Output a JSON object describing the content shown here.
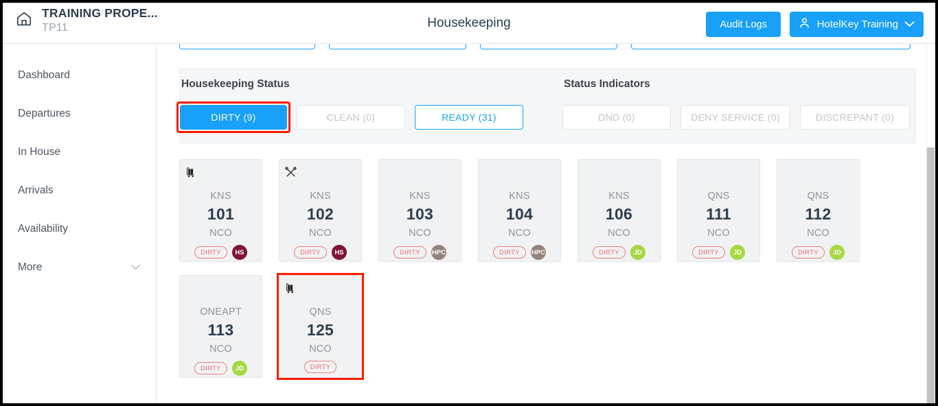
{
  "header": {
    "home_icon": "home-icon",
    "property_name": "TRAINING PROPE...",
    "property_code": "TP11",
    "page_title": "Housekeeping",
    "audit_logs_label": "Audit Logs",
    "user_icon": "person-icon",
    "user_name": "HotelKey Training",
    "user_chevron": "⌄",
    "accent_color": "#18a0fb"
  },
  "sidebar": {
    "items": [
      {
        "label": "Dashboard",
        "chevron": ""
      },
      {
        "label": "Departures",
        "chevron": ""
      },
      {
        "label": "In House",
        "chevron": ""
      },
      {
        "label": "Arrivals",
        "chevron": ""
      },
      {
        "label": "Availability",
        "chevron": ""
      },
      {
        "label": "More",
        "chevron": "⌄"
      }
    ]
  },
  "filters": {
    "housekeeping_status": {
      "label": "Housekeeping Status",
      "buttons": [
        {
          "label": "DIRTY (9)",
          "state": "active",
          "selected": true
        },
        {
          "label": "CLEAN (0)",
          "state": "disabled",
          "selected": false
        },
        {
          "label": "READY (31)",
          "state": "outline",
          "selected": false
        }
      ]
    },
    "status_indicators": {
      "label": "Status Indicators",
      "buttons": [
        {
          "label": "DND (0)",
          "state": "disabled",
          "selected": false
        },
        {
          "label": "DENY SERVICE (0)",
          "state": "disabled",
          "selected": false
        },
        {
          "label": "DISCREPANT (0)",
          "state": "disabled",
          "selected": false
        }
      ]
    },
    "selection_highlight_color": "#ff1c00"
  },
  "rooms": [
    {
      "type": "KNS",
      "number": "101",
      "occupancy": "NCO",
      "status": "DIRTY",
      "icon": "luggage-cart-icon",
      "avatar": "HS",
      "avatar_color": "#7d1538",
      "selected": false
    },
    {
      "type": "KNS",
      "number": "102",
      "occupancy": "NCO",
      "status": "DIRTY",
      "icon": "maintenance-tools-icon",
      "avatar": "HS",
      "avatar_color": "#7d1538",
      "selected": false
    },
    {
      "type": "KNS",
      "number": "103",
      "occupancy": "NCO",
      "status": "DIRTY",
      "icon": "",
      "avatar": "HPC",
      "avatar_color": "#948379",
      "selected": false
    },
    {
      "type": "KNS",
      "number": "104",
      "occupancy": "NCO",
      "status": "DIRTY",
      "icon": "",
      "avatar": "HPC",
      "avatar_color": "#948379",
      "selected": false
    },
    {
      "type": "KNS",
      "number": "106",
      "occupancy": "NCO",
      "status": "DIRTY",
      "icon": "",
      "avatar": "JD",
      "avatar_color": "#a5d943",
      "selected": false
    },
    {
      "type": "QNS",
      "number": "111",
      "occupancy": "NCO",
      "status": "DIRTY",
      "icon": "",
      "avatar": "JD",
      "avatar_color": "#a5d943",
      "selected": false
    },
    {
      "type": "QNS",
      "number": "112",
      "occupancy": "NCO",
      "status": "DIRTY",
      "icon": "",
      "avatar": "JD",
      "avatar_color": "#a5d943",
      "selected": false
    },
    {
      "type": "ONEAPT",
      "number": "113",
      "occupancy": "NCO",
      "status": "DIRTY",
      "icon": "",
      "avatar": "JD",
      "avatar_color": "#a5d943",
      "selected": false
    },
    {
      "type": "QNS",
      "number": "125",
      "occupancy": "NCO",
      "status": "DIRTY",
      "icon": "luggage-cart-icon",
      "avatar": "",
      "avatar_color": "",
      "selected": true
    }
  ]
}
